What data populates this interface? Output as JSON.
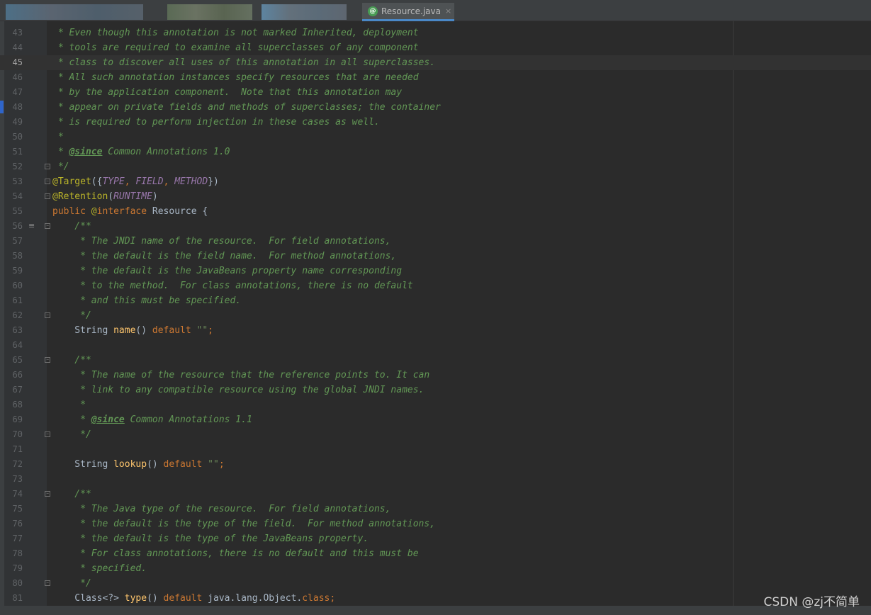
{
  "editor": {
    "active_tab": {
      "label": "Resource.java",
      "icon": "spring-bean-icon",
      "close": "×"
    },
    "inactive_tabs_blurred": [
      "blurred-tab-1",
      "blurred-tab-2",
      "blurred-tab-3"
    ],
    "current_line": "45",
    "lines": [
      {
        "n": "43",
        "fold": false,
        "tokens": [
          {
            "c": "comment",
            "t": " * Even though this annotation is not marked Inherited, deployment"
          }
        ]
      },
      {
        "n": "44",
        "fold": false,
        "tokens": [
          {
            "c": "comment",
            "t": " * tools are required to examine all superclasses of any component"
          }
        ]
      },
      {
        "n": "45",
        "fold": false,
        "tokens": [
          {
            "c": "comment",
            "t": " * class to discover all uses of this annotation in all superclasses."
          }
        ]
      },
      {
        "n": "46",
        "fold": false,
        "tokens": [
          {
            "c": "comment",
            "t": " * All such annotation instances specify resources that are needed"
          }
        ]
      },
      {
        "n": "47",
        "fold": false,
        "tokens": [
          {
            "c": "comment",
            "t": " * by the application component.  Note that this annotation may"
          }
        ]
      },
      {
        "n": "48",
        "fold": false,
        "tokens": [
          {
            "c": "comment",
            "t": " * appear on private fields and methods of superclasses; the container"
          }
        ]
      },
      {
        "n": "49",
        "fold": false,
        "tokens": [
          {
            "c": "comment",
            "t": " * is required to perform injection in these cases as well."
          }
        ]
      },
      {
        "n": "50",
        "fold": false,
        "tokens": [
          {
            "c": "comment",
            "t": " *"
          }
        ]
      },
      {
        "n": "51",
        "fold": false,
        "tokens": [
          {
            "c": "comment",
            "t": " * "
          },
          {
            "c": "tag",
            "t": "@since"
          },
          {
            "c": "comment",
            "t": " Common Annotations 1.0"
          }
        ]
      },
      {
        "n": "52",
        "fold": true,
        "tokens": [
          {
            "c": "comment",
            "t": " */"
          }
        ]
      },
      {
        "n": "53",
        "fold": true,
        "tokens": [
          {
            "c": "ann",
            "t": "@Target"
          },
          {
            "c": "plain",
            "t": "({"
          },
          {
            "c": "const",
            "t": "TYPE"
          },
          {
            "c": "keyword",
            "t": ", "
          },
          {
            "c": "const",
            "t": "FIELD"
          },
          {
            "c": "keyword",
            "t": ", "
          },
          {
            "c": "const",
            "t": "METHOD"
          },
          {
            "c": "plain",
            "t": "})"
          }
        ]
      },
      {
        "n": "54",
        "fold": true,
        "tokens": [
          {
            "c": "ann",
            "t": "@Retention"
          },
          {
            "c": "plain",
            "t": "("
          },
          {
            "c": "const",
            "t": "RUNTIME"
          },
          {
            "c": "plain",
            "t": ")"
          }
        ]
      },
      {
        "n": "55",
        "fold": false,
        "tokens": [
          {
            "c": "keyword",
            "t": "public "
          },
          {
            "c": "ann",
            "t": "@"
          },
          {
            "c": "keyword",
            "t": "interface "
          },
          {
            "c": "plain",
            "t": "Resource {"
          }
        ]
      },
      {
        "n": "56",
        "fold": true,
        "extra": true,
        "tokens": [
          {
            "c": "comment",
            "t": "    /**"
          }
        ]
      },
      {
        "n": "57",
        "fold": false,
        "tokens": [
          {
            "c": "comment",
            "t": "     * The JNDI name of the resource.  For field annotations,"
          }
        ]
      },
      {
        "n": "58",
        "fold": false,
        "tokens": [
          {
            "c": "comment",
            "t": "     * the default is the field name.  For method annotations,"
          }
        ]
      },
      {
        "n": "59",
        "fold": false,
        "tokens": [
          {
            "c": "comment",
            "t": "     * the default is the JavaBeans property name corresponding"
          }
        ]
      },
      {
        "n": "60",
        "fold": false,
        "tokens": [
          {
            "c": "comment",
            "t": "     * to the method.  For class annotations, there is no default"
          }
        ]
      },
      {
        "n": "61",
        "fold": false,
        "tokens": [
          {
            "c": "comment",
            "t": "     * and this must be specified."
          }
        ]
      },
      {
        "n": "62",
        "fold": true,
        "tokens": [
          {
            "c": "comment",
            "t": "     */"
          }
        ]
      },
      {
        "n": "63",
        "fold": false,
        "tokens": [
          {
            "c": "plain",
            "t": "    String "
          },
          {
            "c": "method",
            "t": "name"
          },
          {
            "c": "plain",
            "t": "() "
          },
          {
            "c": "keyword",
            "t": "default "
          },
          {
            "c": "string",
            "t": "\"\""
          },
          {
            "c": "keyword",
            "t": ";"
          }
        ]
      },
      {
        "n": "64",
        "fold": false,
        "tokens": []
      },
      {
        "n": "65",
        "fold": true,
        "tokens": [
          {
            "c": "comment",
            "t": "    /**"
          }
        ]
      },
      {
        "n": "66",
        "fold": false,
        "tokens": [
          {
            "c": "comment",
            "t": "     * The name of the resource that the reference points to. It can"
          }
        ]
      },
      {
        "n": "67",
        "fold": false,
        "tokens": [
          {
            "c": "comment",
            "t": "     * link to any compatible resource using the global JNDI names."
          }
        ]
      },
      {
        "n": "68",
        "fold": false,
        "tokens": [
          {
            "c": "comment",
            "t": "     *"
          }
        ]
      },
      {
        "n": "69",
        "fold": false,
        "tokens": [
          {
            "c": "comment",
            "t": "     * "
          },
          {
            "c": "tag",
            "t": "@since"
          },
          {
            "c": "comment",
            "t": " Common Annotations 1.1"
          }
        ]
      },
      {
        "n": "70",
        "fold": true,
        "tokens": [
          {
            "c": "comment",
            "t": "     */"
          }
        ]
      },
      {
        "n": "71",
        "fold": false,
        "tokens": []
      },
      {
        "n": "72",
        "fold": false,
        "tokens": [
          {
            "c": "plain",
            "t": "    String "
          },
          {
            "c": "method",
            "t": "lookup"
          },
          {
            "c": "plain",
            "t": "() "
          },
          {
            "c": "keyword",
            "t": "default "
          },
          {
            "c": "string",
            "t": "\"\""
          },
          {
            "c": "keyword",
            "t": ";"
          }
        ]
      },
      {
        "n": "73",
        "fold": false,
        "tokens": []
      },
      {
        "n": "74",
        "fold": true,
        "tokens": [
          {
            "c": "comment",
            "t": "    /**"
          }
        ]
      },
      {
        "n": "75",
        "fold": false,
        "tokens": [
          {
            "c": "comment",
            "t": "     * The Java type of the resource.  For field annotations,"
          }
        ]
      },
      {
        "n": "76",
        "fold": false,
        "tokens": [
          {
            "c": "comment",
            "t": "     * the default is the type of the field.  For method annotations,"
          }
        ]
      },
      {
        "n": "77",
        "fold": false,
        "tokens": [
          {
            "c": "comment",
            "t": "     * the default is the type of the JavaBeans property."
          }
        ]
      },
      {
        "n": "78",
        "fold": false,
        "tokens": [
          {
            "c": "comment",
            "t": "     * For class annotations, there is no default and this must be"
          }
        ]
      },
      {
        "n": "79",
        "fold": false,
        "tokens": [
          {
            "c": "comment",
            "t": "     * specified."
          }
        ]
      },
      {
        "n": "80",
        "fold": true,
        "tokens": [
          {
            "c": "comment",
            "t": "     */"
          }
        ]
      },
      {
        "n": "81",
        "fold": false,
        "tokens": [
          {
            "c": "plain",
            "t": "    Class<?> "
          },
          {
            "c": "method",
            "t": "type"
          },
          {
            "c": "plain",
            "t": "() "
          },
          {
            "c": "keyword",
            "t": "default "
          },
          {
            "c": "plain",
            "t": "java.lang.Object."
          },
          {
            "c": "keyword",
            "t": "class;"
          }
        ]
      }
    ]
  },
  "watermark": "CSDN @zj不简单",
  "colors": {
    "background": "#2b2b2b",
    "comment": "#629755",
    "annotation": "#bbb529",
    "keyword": "#cc7832",
    "method": "#ffc66d",
    "constant": "#9876aa",
    "text": "#a9b7c6"
  }
}
